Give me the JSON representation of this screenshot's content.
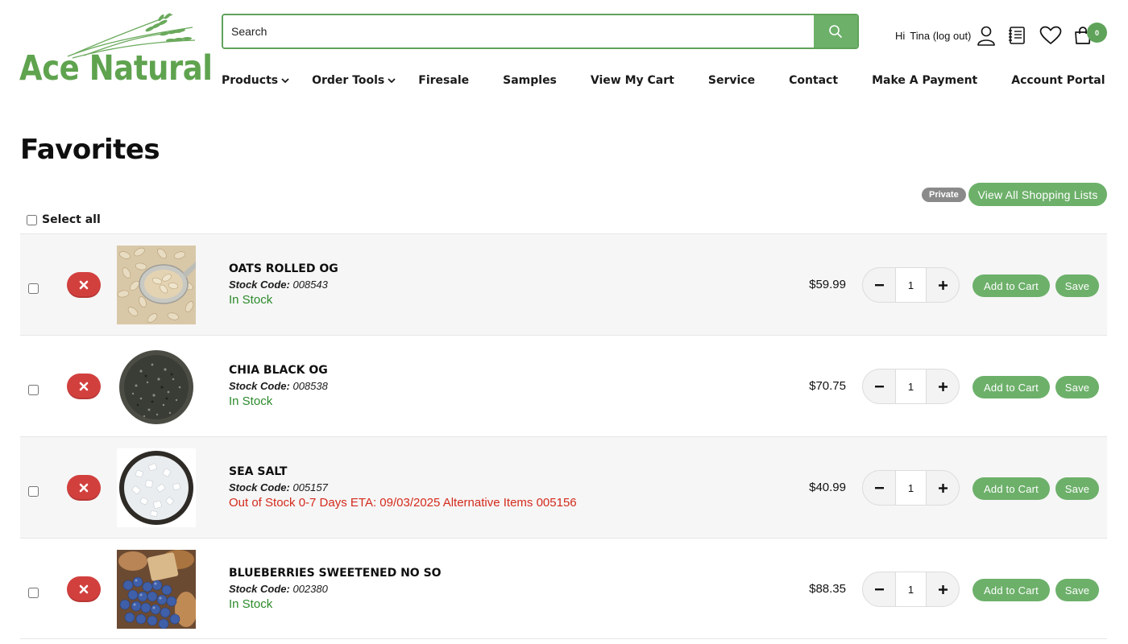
{
  "logo": {
    "text": "Ace Natural",
    "icon": "wheat-icon",
    "color": "#5fa34f"
  },
  "search": {
    "placeholder": "Search",
    "value": "",
    "icon": "search-icon"
  },
  "user": {
    "hi": "Hi",
    "name_logout": "Tina (log out)"
  },
  "header_icons": [
    "user-icon",
    "order-list-icon",
    "heart-icon",
    "shopping-bag-icon"
  ],
  "cart": {
    "count": "0"
  },
  "nav": {
    "items": [
      {
        "label": "Products",
        "has_dropdown": true
      },
      {
        "label": "Order Tools",
        "has_dropdown": true
      },
      {
        "label": "Firesale"
      },
      {
        "label": "Samples"
      },
      {
        "label": "View My Cart"
      },
      {
        "label": "Service"
      },
      {
        "label": "Contact"
      },
      {
        "label": "Make A Payment"
      },
      {
        "label": "Account Portal"
      }
    ]
  },
  "page": {
    "title": "Favorites",
    "private_badge": "Private",
    "view_all_lists": "View All Shopping Lists",
    "select_all": "Select all"
  },
  "row_labels": {
    "stock_code_label": "Stock Code:",
    "add_to_cart": "Add to Cart",
    "save": "Save",
    "minus": "−",
    "plus": "+"
  },
  "items": [
    {
      "name": "OATS ROLLED OG",
      "stock_code": "008543",
      "status": "In Stock",
      "in_stock": true,
      "price": "$59.99",
      "qty": "1",
      "image": "rolled-oats"
    },
    {
      "name": "CHIA BLACK OG",
      "stock_code": "008538",
      "status": "In Stock",
      "in_stock": true,
      "price": "$70.75",
      "qty": "1",
      "image": "chia-seeds"
    },
    {
      "name": "SEA SALT",
      "stock_code": "005157",
      "status": "Out of Stock 0-7 Days ETA: 09/03/2025 Alternative Items 005156",
      "in_stock": false,
      "price": "$40.99",
      "qty": "1",
      "image": "sea-salt"
    },
    {
      "name": "BLUEBERRIES SWEETENED NO SO",
      "stock_code": "002380",
      "status": "In Stock",
      "in_stock": true,
      "price": "$88.35",
      "qty": "1",
      "image": "blueberries"
    }
  ],
  "colors": {
    "accent_green": "#6db06a",
    "remove_red": "#d2403e",
    "in_stock": "#2b8a2b",
    "out_of_stock": "#d42a1c"
  }
}
